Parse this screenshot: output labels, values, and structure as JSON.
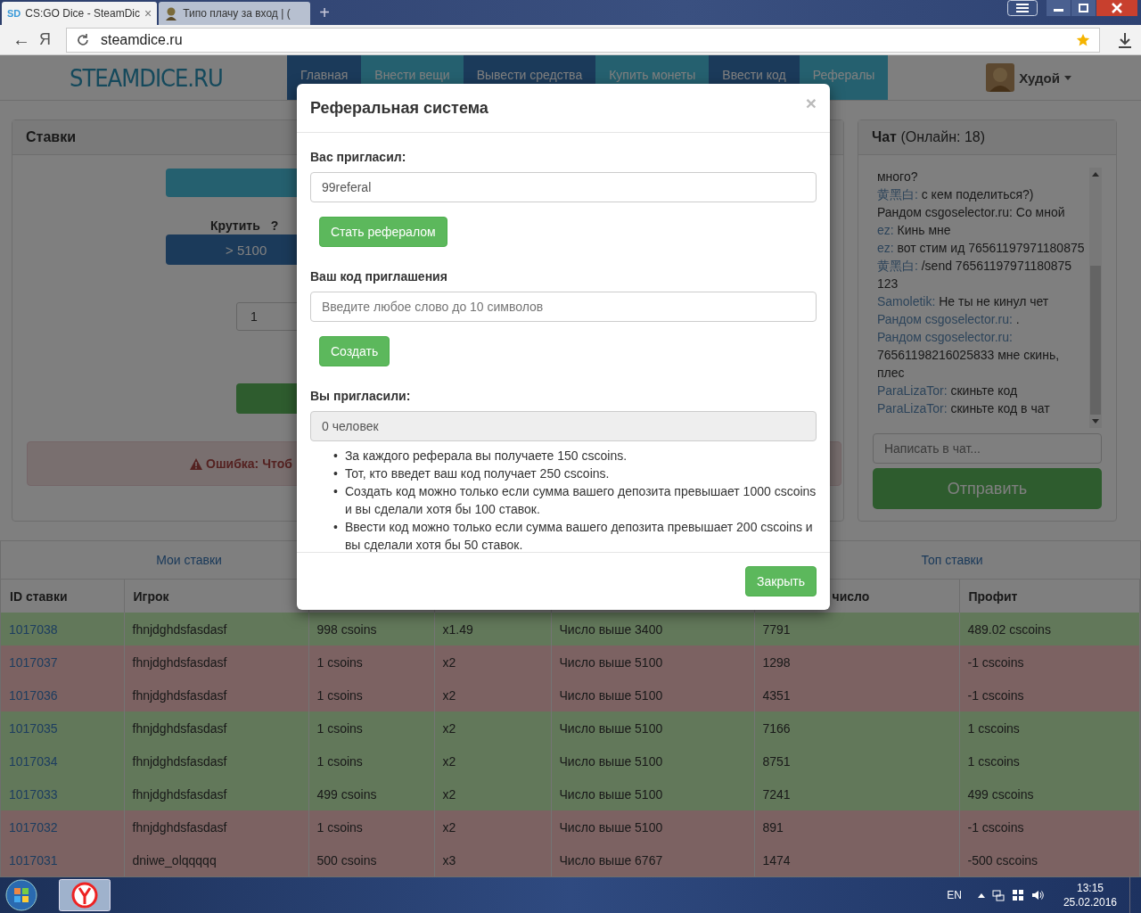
{
  "browser": {
    "tabs": [
      {
        "favicon": "SD",
        "title": "CS:GO Dice - SteamDic",
        "close": "×",
        "selected": true
      },
      {
        "title": "Типо плачу за вход | (",
        "selected": false
      }
    ],
    "new_tab": "+",
    "back": "←",
    "yandex": "Я",
    "url": "steamdice.ru"
  },
  "header": {
    "logo": "STEAMDICE.RU",
    "nav": [
      "Главная",
      "Внести вещи",
      "Вывести средства",
      "Купить монеты",
      "Ввести код",
      "Рефералы"
    ],
    "user": "Худой"
  },
  "bets_panel": {
    "title": "Ставки",
    "spin_label": "Крутить",
    "help": "?",
    "over_button": "> 5100",
    "amount": "1",
    "error": "Ошибка: Чтоб"
  },
  "chat": {
    "title": "Чат",
    "online": "(Онлайн: 18)",
    "messages": [
      {
        "text": "много?"
      },
      {
        "name": "黄黑白:",
        "text": "с кем поделиться?)",
        "linked": true
      },
      {
        "name": "Рандом csgoselector.ru:",
        "text": "Со мной",
        "linked": false
      },
      {
        "name": "ez:",
        "text": "Кинь мне",
        "linked": true
      },
      {
        "name": "ez:",
        "text": "вот стим ид 76561197971180875",
        "linked": true
      },
      {
        "name": "黄黑白:",
        "text": "/send 76561197971180875 123",
        "linked": true
      },
      {
        "name": "Samoletik:",
        "text": "Не ты не кинул чет",
        "linked": true
      },
      {
        "name": "Рандом csgoselector.ru:",
        "text": ".",
        "linked": true
      },
      {
        "name": "Рандом csgoselector.ru:",
        "text": "76561198216025833 мне скинь, плес",
        "linked": true
      },
      {
        "name": "ParaLizaTor:",
        "text": "скиньте код",
        "linked": true
      },
      {
        "name": "ParaLizaTor:",
        "text": "скиньте код в чат",
        "linked": true
      }
    ],
    "placeholder": "Написать в чат...",
    "send": "Отправить"
  },
  "history": {
    "tabs": [
      "Мои ставки",
      "Топ ставки"
    ],
    "columns": {
      "id": "ID ставки",
      "player": "Игрок",
      "number": "число",
      "profit": "Профит"
    },
    "rows": [
      {
        "id": "1017038",
        "player": "fhnjdghdsfasdasf",
        "column_3": "998 csoins",
        "column_4": "x1.49",
        "column_5": "Число выше 3400",
        "number": "7791",
        "profit": "489.02 cscoins",
        "win": true
      },
      {
        "id": "1017037",
        "player": "fhnjdghdsfasdasf",
        "column_3": "1 csoins",
        "column_4": "x2",
        "column_5": "Число выше 5100",
        "number": "1298",
        "profit": "-1 cscoins",
        "win": false
      },
      {
        "id": "1017036",
        "player": "fhnjdghdsfasdasf",
        "column_3": "1 csoins",
        "column_4": "x2",
        "column_5": "Число выше 5100",
        "number": "4351",
        "profit": "-1 cscoins",
        "win": false
      },
      {
        "id": "1017035",
        "player": "fhnjdghdsfasdasf",
        "column_3": "1 csoins",
        "column_4": "x2",
        "column_5": "Число выше 5100",
        "number": "7166",
        "profit": "1 cscoins",
        "win": true
      },
      {
        "id": "1017034",
        "player": "fhnjdghdsfasdasf",
        "column_3": "1 csoins",
        "column_4": "x2",
        "column_5": "Число выше 5100",
        "number": "8751",
        "profit": "1 cscoins",
        "win": true
      },
      {
        "id": "1017033",
        "player": "fhnjdghdsfasdasf",
        "column_3": "499 csoins",
        "column_4": "x2",
        "column_5": "Число выше 5100",
        "number": "7241",
        "profit": "499 cscoins",
        "win": true
      },
      {
        "id": "1017032",
        "player": "fhnjdghdsfasdasf",
        "column_3": "1 csoins",
        "column_4": "x2",
        "column_5": "Число выше 5100",
        "number": "891",
        "profit": "-1 cscoins",
        "win": false
      },
      {
        "id": "1017031",
        "player": "dniwe_olqqqqq",
        "column_3": "500 csoins",
        "column_4": "x3",
        "column_5": "Число выше 6767",
        "number": "1474",
        "profit": "-500 cscoins",
        "win": false
      }
    ]
  },
  "modal": {
    "title": "Реферальная система",
    "close": "×",
    "invited_by_label": "Вас пригласил:",
    "invited_by_value": "99referal",
    "become_button": "Стать рефералом",
    "code_label": "Ваш код приглашения",
    "code_placeholder": "Введите любое слово до 10 символов",
    "create_button": "Создать",
    "invited_label": "Вы пригласили:",
    "invited_value": "0 человек",
    "bullet": "•",
    "rules": [
      "За каждого реферала вы получаете 150 cscoins.",
      "Тот, кто введет ваш код получает 250 cscoins.",
      "Создать код можно только если сумма вашего депозита превышает 1000 cscoins и вы сделали хотя бы 100 ставок.",
      "Ввести код можно только если сумма вашего депозита превышает 200 cscoins и вы сделали хотя бы 50 ставок."
    ],
    "footer_button": "Закрыть"
  },
  "taskbar": {
    "language": "EN",
    "time": "13:15",
    "date": "25.02.2016"
  }
}
